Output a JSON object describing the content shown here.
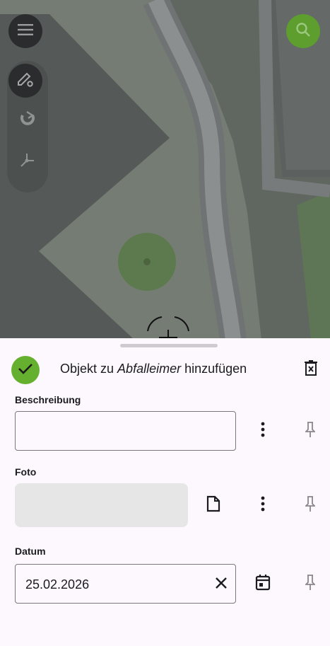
{
  "map": {
    "menu_icon": "menu-icon",
    "edit_tools_icon": "edit-settings-icon",
    "snap_icon": "magnet-icon",
    "vertex_icon": "vertex-icon",
    "search_icon": "search-icon"
  },
  "form": {
    "title_prefix": "Objekt zu ",
    "title_layer": "Abfalleimer",
    "title_suffix": " hinzufügen",
    "fields": {
      "description": {
        "label": "Beschreibung",
        "value": ""
      },
      "photo": {
        "label": "Foto"
      },
      "date": {
        "label": "Datum",
        "value": "25.02.2026"
      }
    }
  },
  "colors": {
    "accent_green": "#66b030",
    "search_green": "#5d9e2f",
    "map_dim": "#5f6760"
  }
}
